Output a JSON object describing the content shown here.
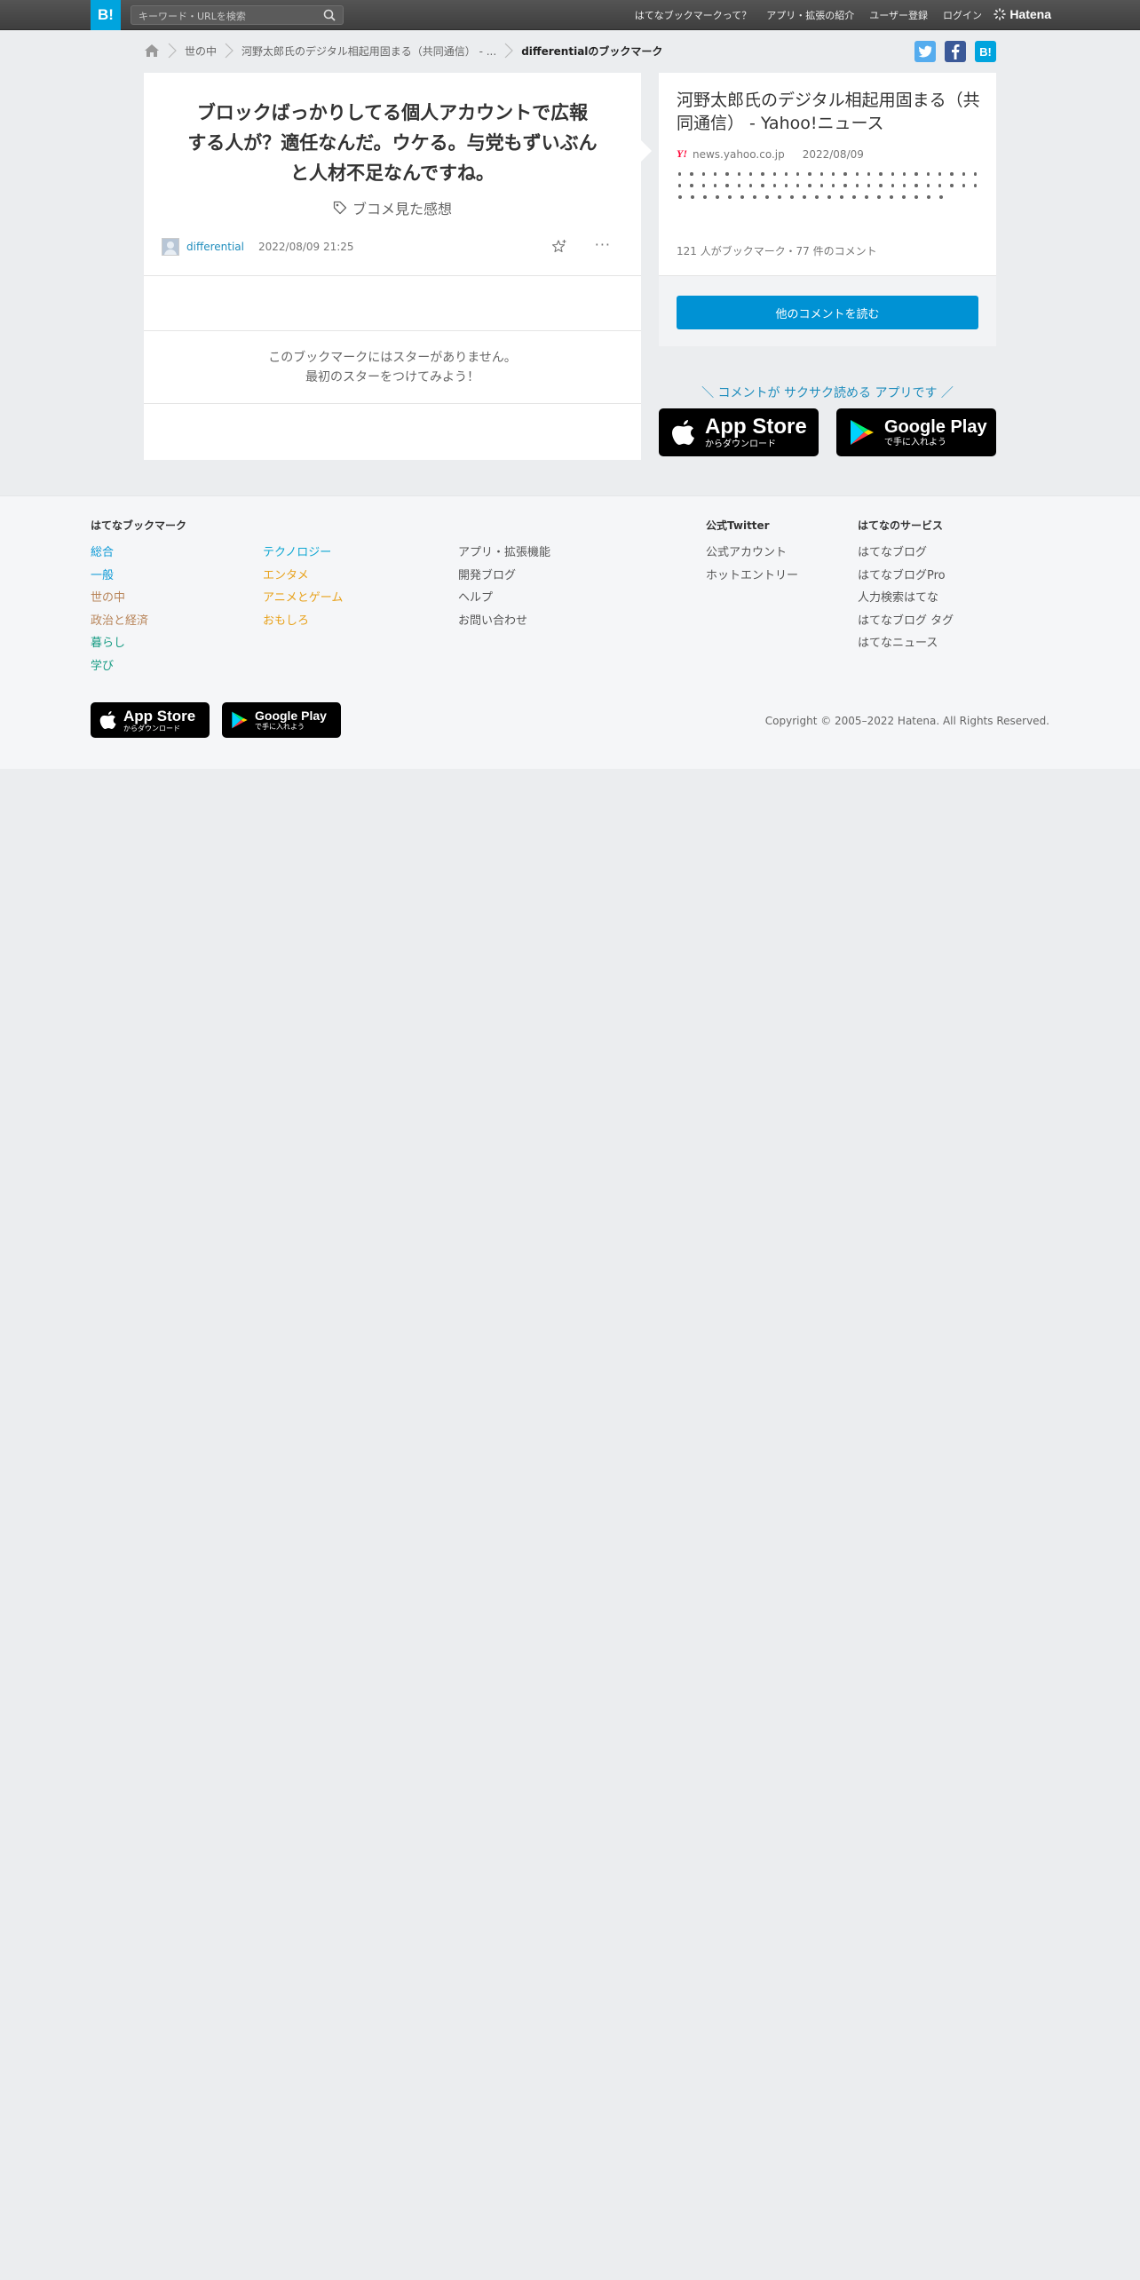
{
  "header": {
    "logo": "B!",
    "search_placeholder": "キーワード・URLを検索",
    "nav": [
      "はてなブックマークって？",
      "アプリ・拡張の紹介",
      "ユーザー登録",
      "ログイン"
    ],
    "brand": "Hatena"
  },
  "breadcrumb": {
    "items": [
      "世の中",
      "河野太郎氏のデジタル相起用固まる（共同通信） - ...",
      "differentialのブックマーク"
    ]
  },
  "share": {
    "twitter": "t",
    "facebook": "f",
    "hatena": "B!"
  },
  "bookmark": {
    "comment_lines": [
      "ブロックばっかりしてる個人アカウントで広報",
      "する人が？適任なんだ。ウケる。与党もずいぶん",
      "と人材不足なんですね。"
    ],
    "tag": "ブコメ見た感想",
    "user": "differential",
    "datetime": "2022/08/09 21:25",
    "more": "···",
    "no_star_line1": "このブックマークにはスターがありません。",
    "no_star_line2": "最初のスターをつけてみよう！"
  },
  "entry": {
    "title": "河野太郎氏のデジタル相起用固まる（共同通信） - Yahoo!ニュース",
    "source_icon": "Y!",
    "domain": "news.yahoo.co.jp",
    "date": "2022/08/09",
    "count_text": "121 人がブックマーク・77 件のコメント",
    "read_more": "他のコメントを読む"
  },
  "promo": {
    "text": "＼ コメントが サクサク読める アプリです ／",
    "appstore_big": "App Store",
    "appstore_small": "からダウンロード",
    "googleplay_big": "Google Play",
    "googleplay_small": "で手に入れよう"
  },
  "footer": {
    "hatena_bookmark": "はてなブックマーク",
    "categories": [
      {
        "label": "総合",
        "color": "#0d9ad6"
      },
      {
        "label": "一般",
        "color": "#0d9ad6"
      },
      {
        "label": "世の中",
        "color": "#b8855a"
      },
      {
        "label": "政治と経済",
        "color": "#b8855a"
      },
      {
        "label": "暮らし",
        "color": "#189c84"
      },
      {
        "label": "学び",
        "color": "#189c84"
      }
    ],
    "categories2": [
      {
        "label": "テクノロジー",
        "color": "#0da6d2"
      },
      {
        "label": "エンタメ",
        "color": "#e8a21c"
      },
      {
        "label": "アニメとゲーム",
        "color": "#e8a21c"
      },
      {
        "label": "おもしろ",
        "color": "#e8a21c"
      }
    ],
    "links3": [
      "アプリ・拡張機能",
      "開発ブログ",
      "ヘルプ",
      "お問い合わせ"
    ],
    "twitter_head": "公式Twitter",
    "twitter_links": [
      "公式アカウント",
      "ホットエントリー"
    ],
    "services_head": "はてなのサービス",
    "services": [
      "はてなブログ",
      "はてなブログPro",
      "人力検索はてな",
      "はてなブログ タグ",
      "はてなニュース"
    ],
    "copyright": "Copyright © 2005–2022 Hatena. All Rights Reserved."
  }
}
